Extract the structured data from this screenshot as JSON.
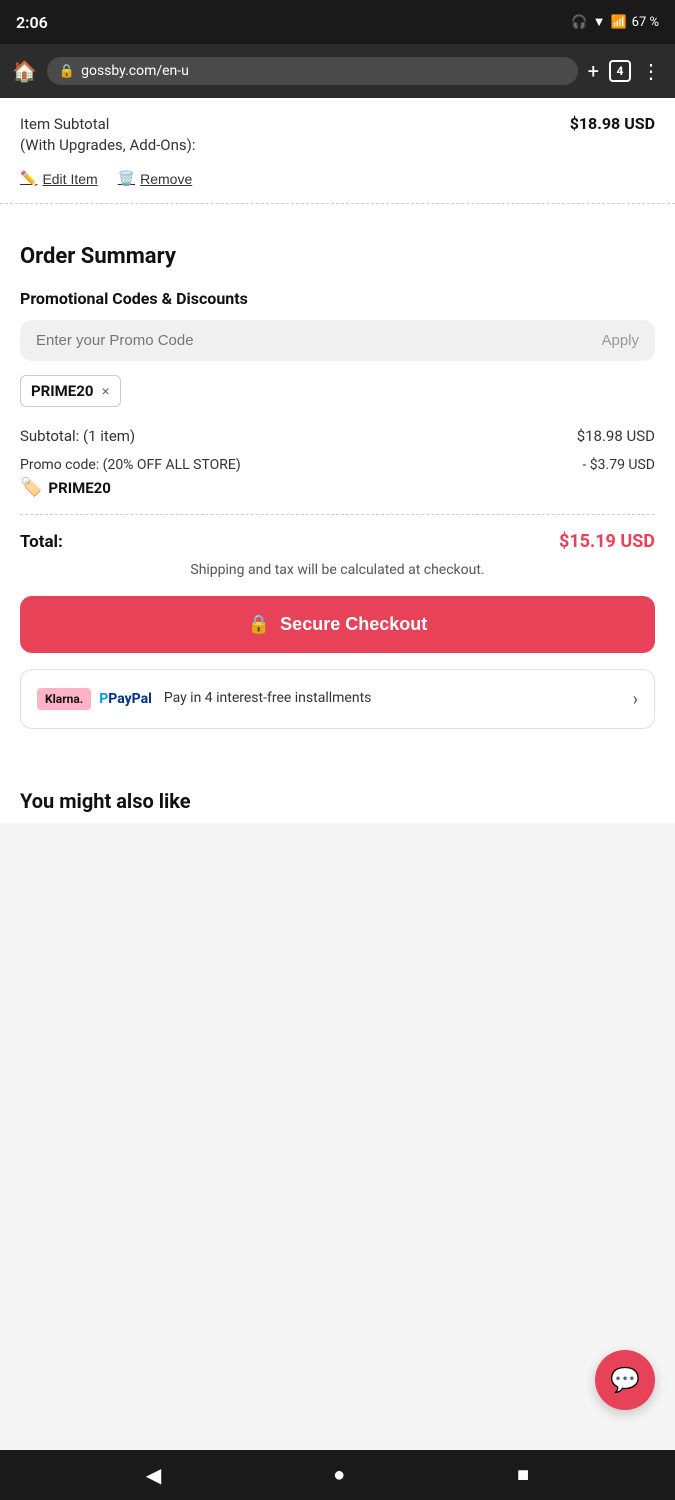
{
  "statusBar": {
    "time": "2:06",
    "battery": "67 %",
    "icons": "headphones wifi signal battery"
  },
  "browserBar": {
    "url": "gossby.com/en-u",
    "tabCount": "4",
    "homeIcon": "🏠",
    "lockIcon": "🔒"
  },
  "cartItem": {
    "subtotalLabel": "Item Subtotal\n(With Upgrades, Add-Ons):",
    "subtotalPrice": "$18.98 USD",
    "editLabel": "Edit Item",
    "removeLabel": "Remove"
  },
  "orderSummary": {
    "title": "Order Summary",
    "promoSectionTitle": "Promotional Codes & Discounts",
    "promoPlaceholder": "Enter your Promo Code",
    "applyLabel": "Apply",
    "appliedCode": "PRIME20",
    "removeX": "×",
    "subtotalLabel": "Subtotal: (1 item)",
    "subtotalValue": "$18.98 USD",
    "promoCodeLabel": "Promo code: (20% OFF ALL STORE)",
    "promoCodeValue": "- $3.79 USD",
    "promoCodeBadge": "🏷️",
    "promoCodeName": "PRIME20",
    "totalLabel": "Total:",
    "totalValue": "$15.19 USD",
    "shippingNote": "Shipping and tax will be calculated at checkout.",
    "checkoutLabel": "Secure Checkout",
    "lockIcon": "🔒"
  },
  "payment": {
    "klarnaLabel": "Klarna.",
    "paypalLabel": "PayPal",
    "paypalP": "P",
    "text": "Pay in 4 interest-free installments",
    "chevron": "›"
  },
  "youMightAlsoLike": {
    "title": "You might also like"
  },
  "nav": {
    "back": "◀",
    "home": "●",
    "recent": "■"
  }
}
